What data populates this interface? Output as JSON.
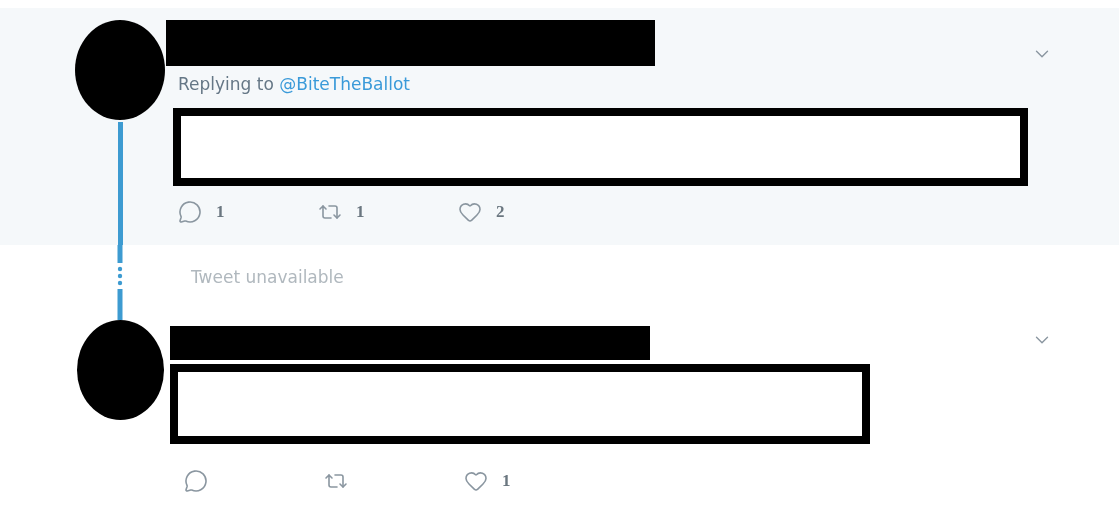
{
  "thread": [
    {
      "kind": "tweet",
      "replying_prefix": "Replying to",
      "replying_handle": "@BiteTheBallot",
      "actions": [
        {
          "kind": "reply",
          "count": "1"
        },
        {
          "kind": "retweet",
          "count": "1"
        },
        {
          "kind": "like",
          "count": "2"
        }
      ]
    },
    {
      "kind": "unavailable",
      "text": "Tweet unavailable"
    },
    {
      "kind": "tweet",
      "actions": [
        {
          "kind": "reply"
        },
        {
          "kind": "retweet"
        },
        {
          "kind": "like",
          "count": "1"
        }
      ]
    }
  ]
}
